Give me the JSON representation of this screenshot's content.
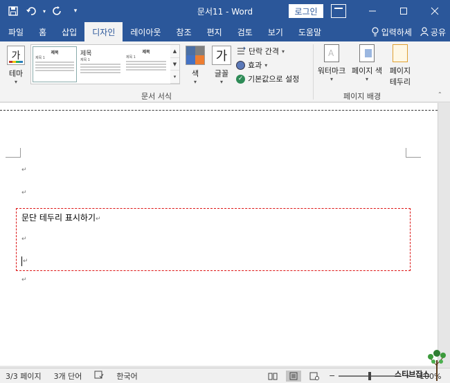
{
  "window": {
    "title": "문서11  -  Word",
    "login_label": "로그인"
  },
  "tabs": [
    "파일",
    "홈",
    "삽입",
    "디자인",
    "레이아웃",
    "참조",
    "편지",
    "검토",
    "보기",
    "도움말"
  ],
  "active_tab": "디자인",
  "tab_right": {
    "tell_me": "입력하세",
    "share": "공유"
  },
  "ribbon": {
    "themes_label": "테마",
    "theme_glyph": "가",
    "gallery_thumbs": [
      {
        "title": "제목",
        "heading": "제목 1"
      },
      {
        "title": "제목",
        "heading": "제목 1"
      },
      {
        "title": "제목",
        "heading": "제목 1"
      }
    ],
    "colors_label": "색",
    "fonts_glyph": "가",
    "fonts_label": "글꼴",
    "paragraph_spacing": "단락 간격",
    "effects": "효과",
    "set_default": "기본값으로 설정",
    "group_doc_format": "문서 서식",
    "watermark": "워터마크",
    "page_color": "페이지 색",
    "page_borders_1": "페이지",
    "page_borders_2": "테두리",
    "group_page_bg": "페이지 배경"
  },
  "document": {
    "bordered_text": "문단 테두리 표시하기",
    "para_mark": "↵"
  },
  "status": {
    "page": "3/3 페이지",
    "words": "3개 단어",
    "language": "한국어",
    "zoom": "100%",
    "zoom_fraction": 0.5
  },
  "watermark_text": "스티브잡스",
  "colors": {
    "brand": "#2b579a",
    "border_dash": "#dd1111"
  }
}
